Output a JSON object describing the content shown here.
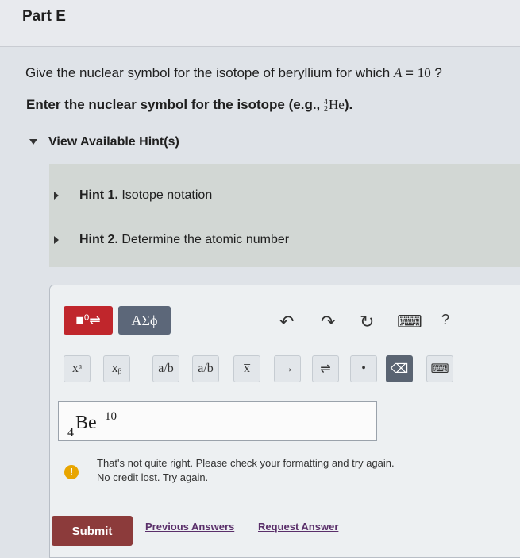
{
  "part": {
    "title": "Part E"
  },
  "question": {
    "text": "Give the nuclear symbol for the isotope of beryllium for which ",
    "var": "A",
    "eq": " = ",
    "num": "10",
    "tail": " ?"
  },
  "instruction": {
    "text": "Enter the nuclear symbol for the isotope (e.g., ",
    "example_mass": "4",
    "example_atomic": "2",
    "example_symbol": "He",
    "tail": ")."
  },
  "hints": {
    "toggle_label": "View Available Hint(s)",
    "items": [
      {
        "number": "Hint 1.",
        "label": "Isotope notation"
      },
      {
        "number": "Hint 2.",
        "label": "Determine the atomic number"
      }
    ]
  },
  "toolbar": {
    "template_label": "■⁰⇌",
    "greek_label": "ΑΣϕ",
    "undo_icon": "↶",
    "redo_icon": "↷",
    "reset_icon": "↻",
    "keyboard_icon": "⌨",
    "help_icon": "?"
  },
  "keys": {
    "superscript": "xᵃ",
    "subscript": "xᵦ",
    "fraction": "a/b",
    "fraction_alt": "a/b",
    "vector": "x̅",
    "arrow": "→",
    "equilibrium": "⇌",
    "dot": "•",
    "delete": "⌫",
    "keypad": "⌨"
  },
  "answer": {
    "symbol": "Be",
    "superscript": "10",
    "subscript": "4"
  },
  "feedback": {
    "icon": "!",
    "line1": "That's not quite right. Please check your formatting and try again.",
    "line2": "No credit lost. Try again."
  },
  "actions": {
    "submit_label": "Submit",
    "previous_label": "Previous Answers",
    "request_label": "Request Answer"
  },
  "colors": {
    "submit": "#8c3b3b",
    "template_button": "#c0262c",
    "greek_button": "#5c6779",
    "warning": "#e8a500"
  }
}
